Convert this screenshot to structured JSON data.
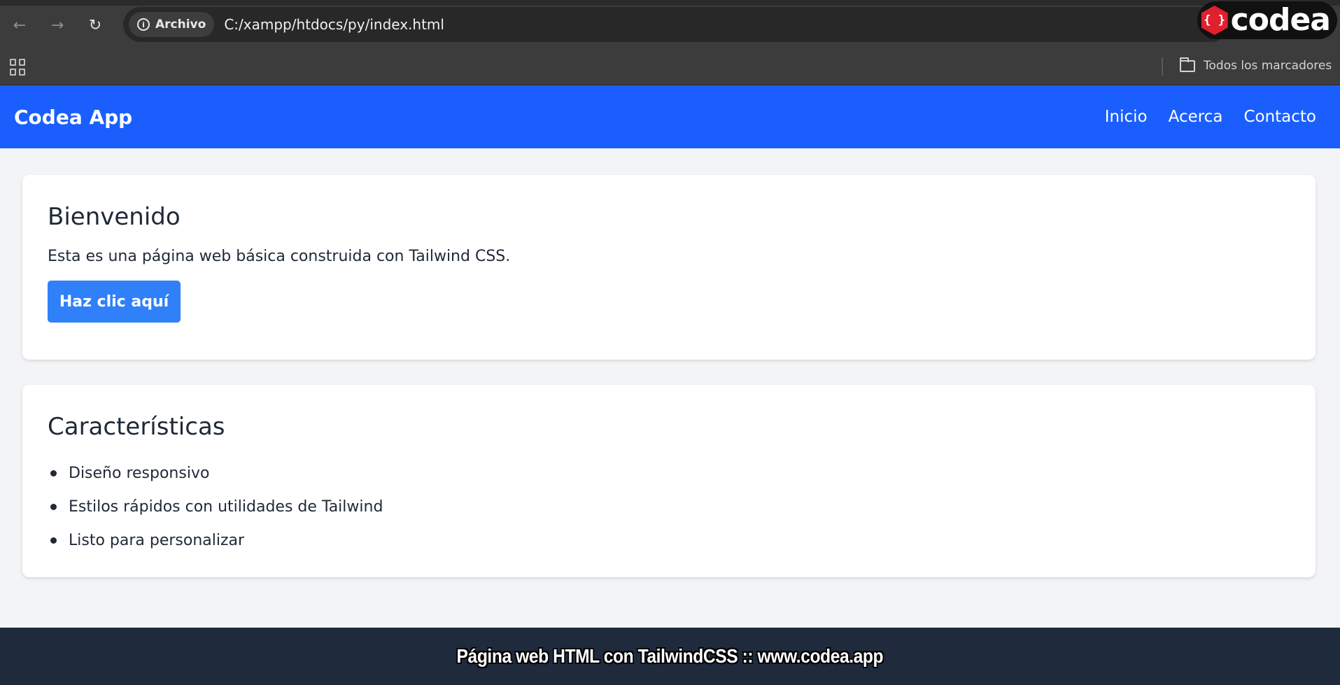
{
  "browser": {
    "security_chip": "Archivo",
    "url": "C:/xampp/htdocs/py/index.html",
    "bookmarks_folder": "Todos los marcadores"
  },
  "watermark": {
    "logo_text": "codea",
    "logo_glyph": "{ }"
  },
  "navbar": {
    "brand": "Codea App",
    "links": [
      "Inicio",
      "Acerca",
      "Contacto"
    ]
  },
  "welcome": {
    "title": "Bienvenido",
    "text": "Esta es una página web básica construida con Tailwind CSS.",
    "button_label": "Haz clic aquí"
  },
  "features": {
    "title": "Características",
    "items": [
      "Diseño responsivo",
      "Estilos rápidos con utilidades de Tailwind",
      "Listo para personalizar"
    ]
  },
  "caption": "Página web HTML con TailwindCSS :: www.codea.app",
  "colors": {
    "navbar": "#1a5ffe",
    "button": "#2f80f9",
    "footer": "#1f2a3c"
  }
}
